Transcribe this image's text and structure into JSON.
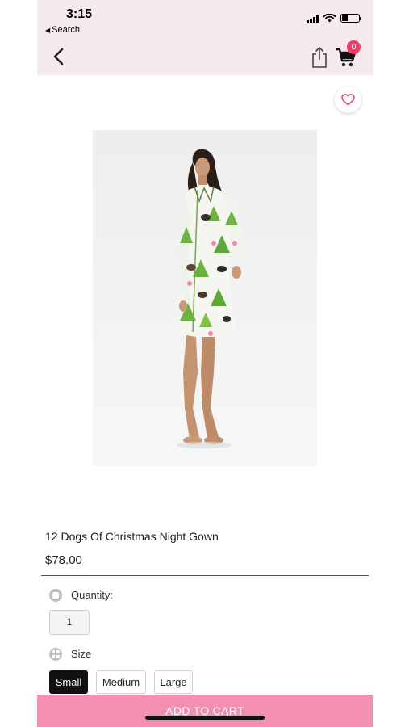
{
  "status_bar": {
    "time": "3:15",
    "back_app": "Search"
  },
  "header": {
    "cart_count": "0"
  },
  "product": {
    "title": "12 Dogs Of Christmas Night Gown",
    "price": "$78.00"
  },
  "options": {
    "quantity_label": "Quantity:",
    "quantity_value": "1",
    "size_label": "Size",
    "sizes": [
      "Small",
      "Medium",
      "Large"
    ],
    "selected_size": "Small"
  },
  "actions": {
    "add_to_cart": "ADD TO CART"
  },
  "colors": {
    "header_bg": "#f6e9ef",
    "accent_pink": "#f28fb2",
    "badge": "#ef3d6a",
    "selected": "#111111"
  }
}
